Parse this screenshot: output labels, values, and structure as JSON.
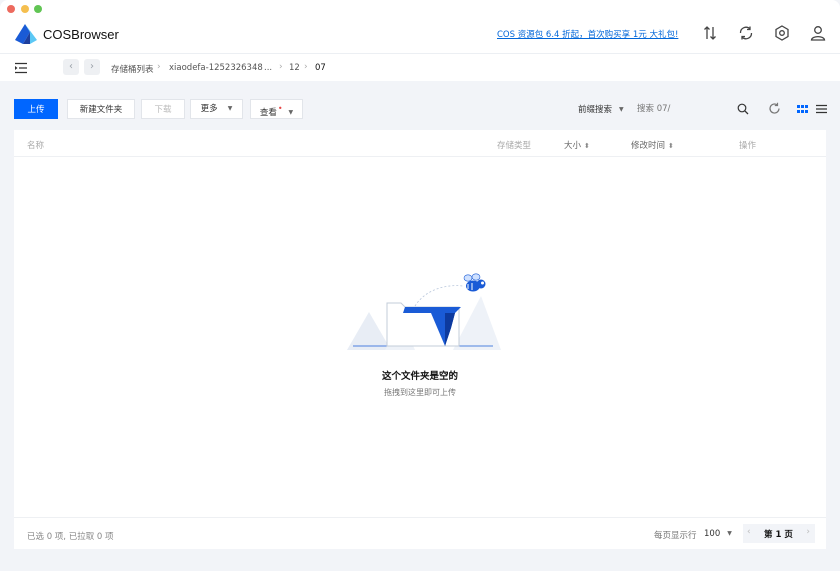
{
  "app": {
    "name": "COSBrowser",
    "promo": "COS 资源包 6.4 折起，首次购买享 1元 大礼包!"
  },
  "colors": {
    "accent": "#0066ff",
    "promo_link": "#0066d9",
    "logo_blue": "#1a5bd6",
    "logo_light": "#5cc8f5"
  },
  "breadcrumb": {
    "items": [
      "存储桶列表",
      "xiaodefa-1252326348",
      "...",
      "12",
      "07"
    ]
  },
  "toolbar": {
    "upload": "上传",
    "new_folder": "新建文件夹",
    "download": "下载",
    "more": "更多",
    "view": "查看",
    "search_mode": "前缀搜索",
    "search_placeholder": "搜索 07/"
  },
  "table": {
    "columns": {
      "name": "名称",
      "storage_class": "存储类型",
      "size": "大小",
      "modified": "修改时间",
      "actions": "操作"
    }
  },
  "empty": {
    "title": "这个文件夹是空的",
    "subtitle": "拖拽到这里即可上传"
  },
  "footer": {
    "selected": "已选 0 项, 已拉取 0 项",
    "per_page_label": "每页显示行",
    "per_page": "100",
    "page": "第 1 页"
  },
  "icons": {
    "top": [
      "transfer-icon",
      "sync-icon",
      "settings-icon",
      "user-icon"
    ],
    "toolbar": [
      "search-icon",
      "refresh-icon",
      "grid-view-icon",
      "list-view-icon"
    ]
  }
}
